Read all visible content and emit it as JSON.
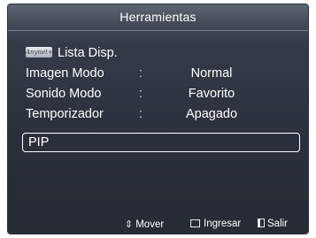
{
  "title": "Herramientas",
  "menu": {
    "items": [
      {
        "label": "Lista Disp.",
        "icon": "anynet-icon",
        "icon_text": "Anynet+"
      },
      {
        "label": "Imagen Modo",
        "separator": ":",
        "value": "Normal"
      },
      {
        "label": "Sonido Modo",
        "separator": ":",
        "value": "Favorito"
      },
      {
        "label": "Temporizador",
        "separator": ":",
        "value": "Apagado"
      },
      {
        "label": "PIP",
        "selected": true
      }
    ]
  },
  "footer": {
    "move_label": "Mover",
    "enter_label": "Ingresar",
    "exit_label": "Salir"
  },
  "colors": {
    "panel": "#2a303a",
    "title_bar": "#4a525e",
    "text": "#ffffff"
  }
}
